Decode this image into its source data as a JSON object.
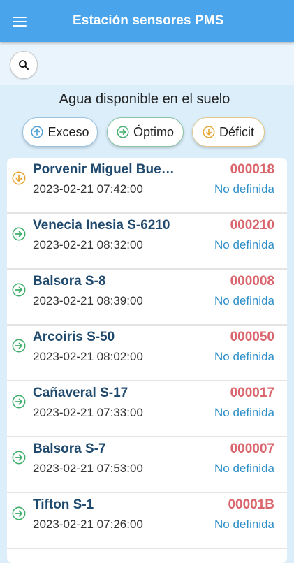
{
  "appbar": {
    "title": "Estación sensores PMS"
  },
  "section": {
    "title": "Agua disponible en el suelo"
  },
  "filters": [
    {
      "label": "Exceso",
      "icon": "arrow-up-circle-icon",
      "color": "#4a9fd6"
    },
    {
      "label": "Óptimo",
      "icon": "arrow-right-circle-icon",
      "color": "#3fae6a"
    },
    {
      "label": "Déficit",
      "icon": "arrow-down-circle-icon",
      "color": "#e6a531"
    }
  ],
  "colors": {
    "appbar": "#4aa4ec",
    "code": "#d9666c",
    "state": "#2e8fc8",
    "name": "#1f4a6e"
  },
  "stations": [
    {
      "name": "Porvenir Miguel Bue…",
      "datetime": "2023-02-21 07:42:00",
      "code": "000018",
      "state": "No definida",
      "icon": "arrow-down-circle-icon"
    },
    {
      "name": "Venecia Inesia S-6210",
      "datetime": "2023-02-21 08:32:00",
      "code": "000210",
      "state": "No definida",
      "icon": "arrow-right-circle-icon"
    },
    {
      "name": "Balsora S-8",
      "datetime": "2023-02-21 08:39:00",
      "code": "000008",
      "state": "No definida",
      "icon": "arrow-right-circle-icon"
    },
    {
      "name": "Arcoiris S-50",
      "datetime": "2023-02-21 08:02:00",
      "code": "000050",
      "state": "No definida",
      "icon": "arrow-right-circle-icon"
    },
    {
      "name": "Cañaveral S-17",
      "datetime": "2023-02-21 07:33:00",
      "code": "000017",
      "state": "No definida",
      "icon": "arrow-right-circle-icon"
    },
    {
      "name": "Balsora S-7",
      "datetime": "2023-02-21 07:53:00",
      "code": "000007",
      "state": "No definida",
      "icon": "arrow-right-circle-icon"
    },
    {
      "name": "Tifton S-1",
      "datetime": "2023-02-21 07:26:00",
      "code": "00001B",
      "state": "No definida",
      "icon": "arrow-right-circle-icon"
    }
  ]
}
